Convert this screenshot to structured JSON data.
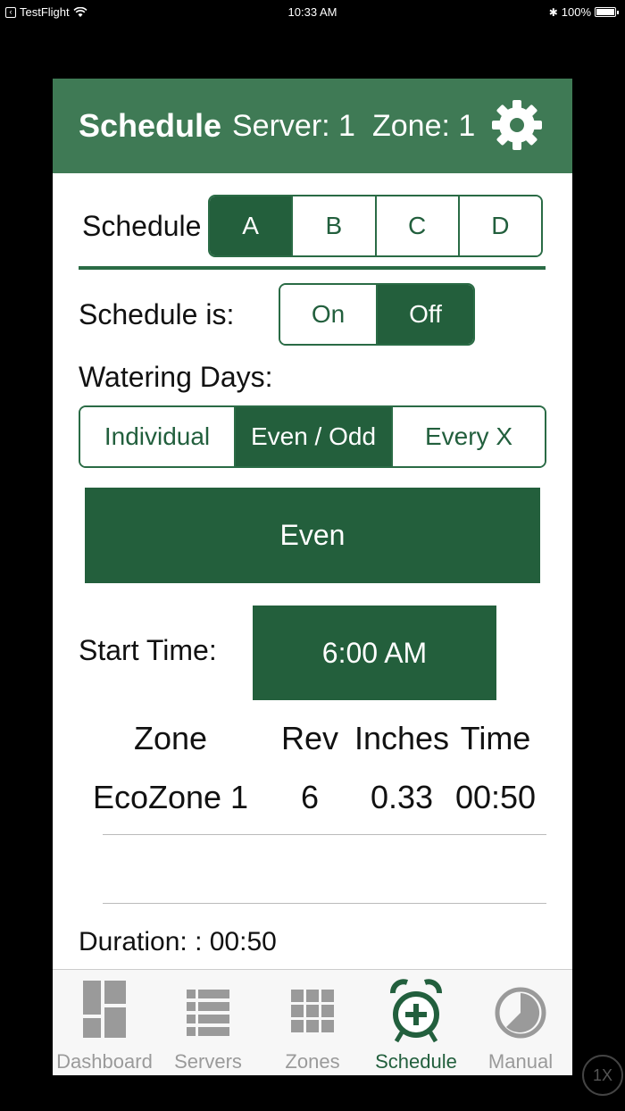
{
  "status_bar": {
    "app": "TestFlight",
    "time": "10:33 AM",
    "battery": "100%"
  },
  "header": {
    "title": "Schedule",
    "server": "Server: 1",
    "zone": "Zone: 1"
  },
  "schedule_selector": {
    "label": "Schedule",
    "options": [
      "A",
      "B",
      "C",
      "D"
    ],
    "selected": "A"
  },
  "schedule_state": {
    "label": "Schedule is:",
    "options": [
      "On",
      "Off"
    ],
    "selected": "Off"
  },
  "watering_days": {
    "label": "Watering Days:",
    "options": [
      "Individual",
      "Even / Odd",
      "Every X"
    ],
    "selected": "Even / Odd",
    "parity_button": "Even"
  },
  "start_time": {
    "label": "Start Time:",
    "value": "6:00 AM"
  },
  "zone_table": {
    "headers": [
      "Zone",
      "Rev",
      "Inches",
      "Time"
    ],
    "rows": [
      [
        "EcoZone 1",
        "6",
        "0.33",
        "00:50"
      ]
    ]
  },
  "duration": "Duration: : 00:50",
  "tabs": [
    {
      "label": "Dashboard",
      "icon": "dashboard-icon"
    },
    {
      "label": "Servers",
      "icon": "servers-icon"
    },
    {
      "label": "Zones",
      "icon": "zones-icon"
    },
    {
      "label": "Schedule",
      "icon": "schedule-icon"
    },
    {
      "label": "Manual",
      "icon": "manual-icon"
    }
  ],
  "active_tab": "Schedule",
  "zoom_badge": "1X",
  "colors": {
    "header_green": "#3f7a55",
    "active_green": "#235f3c",
    "inactive_gray": "#9a9a9a"
  }
}
